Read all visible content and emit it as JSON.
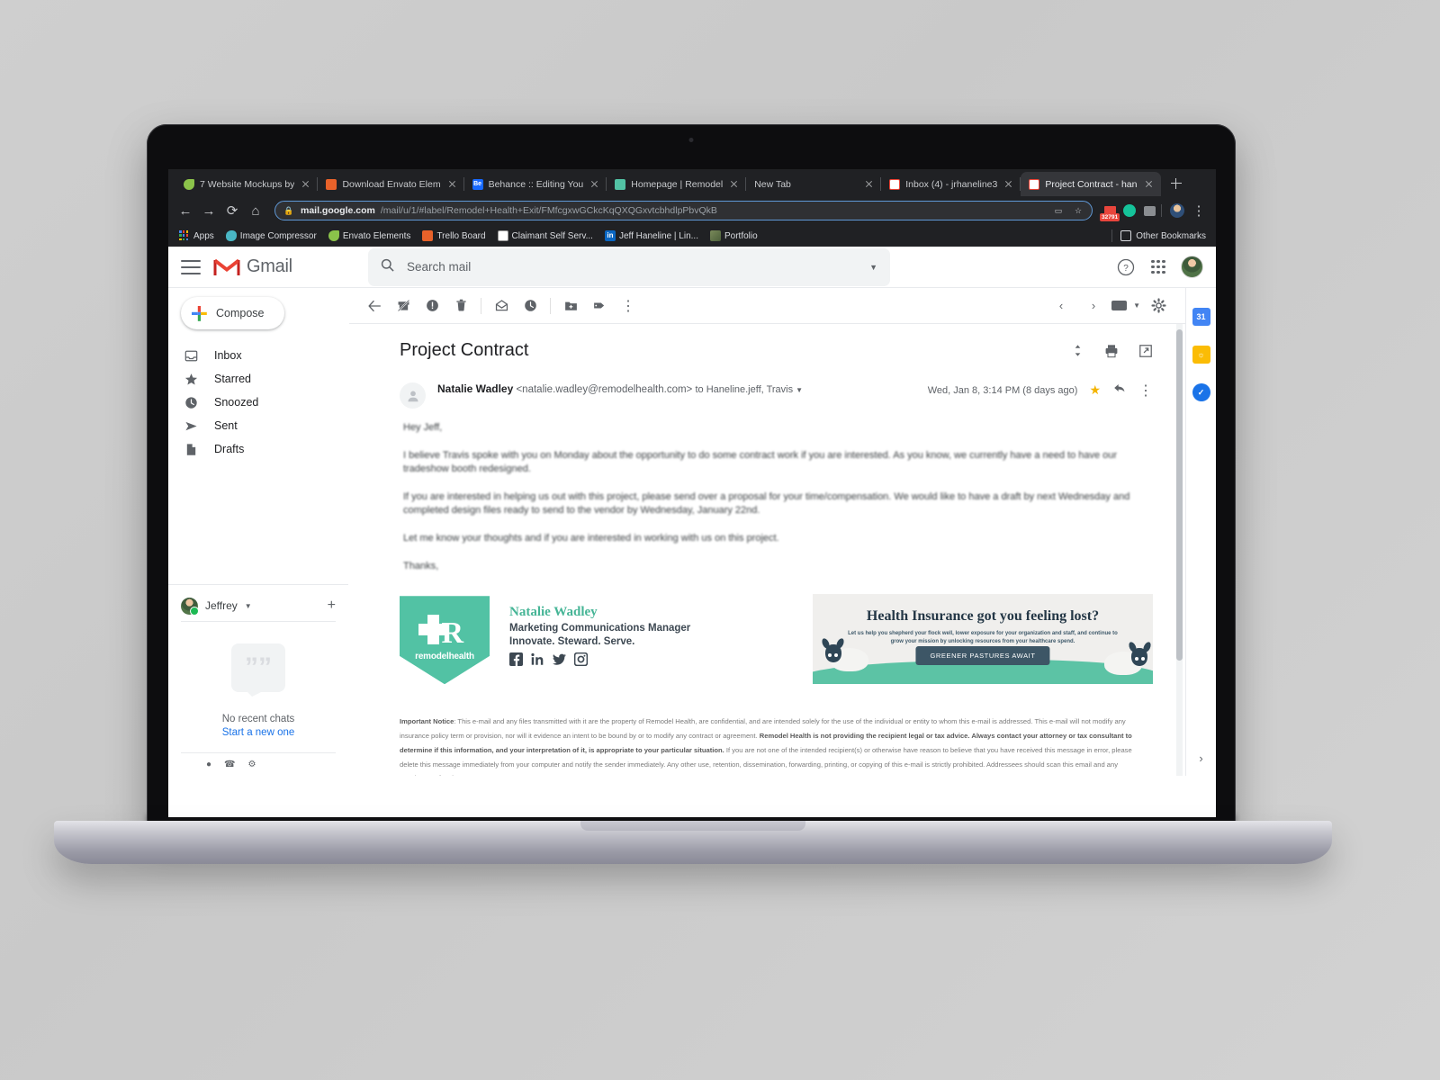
{
  "device": {
    "brand": "MacBook Air"
  },
  "browser": {
    "tabs": [
      {
        "title": "7 Website Mockups by",
        "favicon": "envato-leaf-icon",
        "active": false
      },
      {
        "title": "Download Envato Elem",
        "favicon": "envato-elements-icon",
        "active": false
      },
      {
        "title": "Behance :: Editing You",
        "favicon": "behance-icon",
        "active": false
      },
      {
        "title": "Homepage | Remodel",
        "favicon": "remodel-health-icon",
        "active": false
      },
      {
        "title": "New Tab",
        "favicon": "blank-icon",
        "active": false
      },
      {
        "title": "Inbox (4) - jrhaneline3",
        "favicon": "gmail-icon",
        "active": false
      },
      {
        "title": "Project Contract - han",
        "favicon": "gmail-icon",
        "active": true
      }
    ],
    "new_tab_label": "+",
    "url_domain": "mail.google.com",
    "url_path": "/mail/u/1/#label/Remodel+Health+Exit/FMfcgxwGCkcKqQXQGxvtcbhdlpPbvQkB",
    "extension_badge": "32791",
    "bookmarks": [
      {
        "label": "Apps",
        "icon": "apps-grid-icon"
      },
      {
        "label": "Image Compressor",
        "icon": "image-compressor-icon"
      },
      {
        "label": "Envato Elements",
        "icon": "envato-leaf-icon"
      },
      {
        "label": "Trello Board",
        "icon": "trello-icon"
      },
      {
        "label": "Claimant Self Serv...",
        "icon": "claimant-icon"
      },
      {
        "label": "Jeff Haneline | Lin...",
        "icon": "linkedin-icon"
      },
      {
        "label": "Portfolio",
        "icon": "portfolio-icon"
      }
    ],
    "other_bookmarks": "Other Bookmarks"
  },
  "gmail": {
    "app_name": "Gmail",
    "search": {
      "placeholder": "Search mail"
    },
    "compose_label": "Compose",
    "nav": [
      {
        "label": "Inbox",
        "icon": "inbox-icon"
      },
      {
        "label": "Starred",
        "icon": "star-icon"
      },
      {
        "label": "Snoozed",
        "icon": "clock-icon"
      },
      {
        "label": "Sent",
        "icon": "send-icon"
      },
      {
        "label": "Drafts",
        "icon": "drafts-icon"
      }
    ],
    "chat": {
      "user": "Jeffrey",
      "empty_title": "No recent chats",
      "empty_link": "Start a new one"
    },
    "message": {
      "subject": "Project Contract",
      "sender_name": "Natalie Wadley",
      "sender_email": "<natalie.wadley@remodelhealth.com>",
      "recipients": "to Haneline.jeff, Travis",
      "date": "Wed, Jan 8, 3:14 PM (8 days ago)",
      "body": [
        "Hey Jeff,",
        "I believe Travis spoke with you on Monday about the opportunity to do some contract work if you are interested. As you know, we currently have a need to have our tradeshow booth redesigned.",
        "If you are interested in helping us out with this project, please send over a proposal for your time/compensation. We would like to have a draft by next Wednesday and completed design files ready to send to the vendor by Wednesday, January 22nd.",
        "Let me know your thoughts and if you are interested in working with us on this project.",
        "Thanks,"
      ],
      "signature": {
        "logo_text": "remodelhealth",
        "name": "Natalie Wadley",
        "role": "Marketing Communications Manager",
        "tagline": "Innovate. Steward. Serve.",
        "socials": [
          "facebook-icon",
          "linkedin-icon",
          "twitter-icon",
          "instagram-icon"
        ]
      },
      "banner": {
        "title": "Health Insurance got you feeling lost?",
        "subtitle": "Let us help you shepherd your flock well, lower exposure for your organization and staff, and continue to grow your mission by unlocking resources from your healthcare spend.",
        "cta": "GREENER PASTURES AWAIT"
      },
      "notice_label": "Important Notice",
      "notice_text": ": This e-mail and any files transmitted with it are the property of Remodel Health, are confidential, and are intended solely for the use of the individual or entity to whom this e-mail is addressed. This e-mail will not modify any insurance policy term or provision, nor will it evidence an intent to be bound by or to modify any contract or agreement. ",
      "notice_bold2": "Remodel Health is not providing the recipient legal or tax advice. Always contact your attorney or tax consultant to determine if this information, and your interpretation of it, is appropriate to your particular situation.",
      "notice_text2": "  If you are not one of the intended recipient(s) or otherwise have reason to believe that you have received this message in error, please delete this message immediately from your computer and notify the sender immediately. Any other use, retention, dissemination, forwarding, printing, or copying of this e-mail is strictly prohibited. Addressees should scan this email and any attachments for viruses."
    }
  },
  "colors": {
    "accent_green": "#52c2a4",
    "gmail_red": "#ea4335",
    "link_blue": "#1a73e8",
    "star_gold": "#f4b400"
  }
}
